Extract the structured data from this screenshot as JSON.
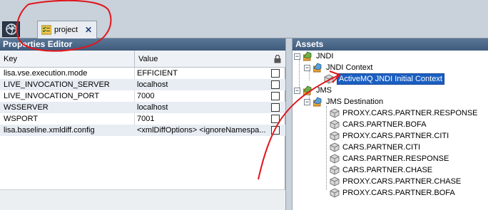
{
  "tab": {
    "label": "project",
    "close": "✕"
  },
  "properties_editor": {
    "title": "Properties Editor",
    "columns": {
      "key": "Key",
      "value": "Value"
    },
    "rows": [
      {
        "key": "lisa.vse.execution.mode",
        "value": "EFFICIENT"
      },
      {
        "key": "LIVE_INVOCATION_SERVER",
        "value": "localhost"
      },
      {
        "key": "LIVE_INVOCATION_PORT",
        "value": "7000"
      },
      {
        "key": "WSSERVER",
        "value": "localhost"
      },
      {
        "key": "WSPORT",
        "value": "7001"
      },
      {
        "key": "lisa.baseline.xmldiff.config",
        "value": "<xmlDiffOptions>  <ignoreNamespa..."
      }
    ]
  },
  "assets": {
    "title": "Assets",
    "tree": {
      "jndi": "JNDI",
      "jndi_context": "JNDI Context",
      "activemq": "ActiveMQ JNDI Initial Context",
      "jms": "JMS",
      "jms_destination": "JMS Destination",
      "destinations": [
        "PROXY.CARS.PARTNER.RESPONSE",
        "CARS.PARTNER.BOFA",
        "PROXY.CARS.PARTNER.CITI",
        "CARS.PARTNER.CITI",
        "CARS.PARTNER.RESPONSE",
        "CARS.PARTNER.CHASE",
        "PROXY.CARS.PARTNER.CHASE",
        "PROXY.CARS.PARTNER.BOFA"
      ]
    }
  },
  "colors": {
    "header": "#4b6788",
    "selection": "#1b5fc1",
    "annotation": "#e0161b"
  },
  "icons": {
    "app": "aperture-icon",
    "tab": "checklist-icon",
    "lock": "lock-icon",
    "node": "folder-cube-icon",
    "leaf": "cube-icon"
  }
}
